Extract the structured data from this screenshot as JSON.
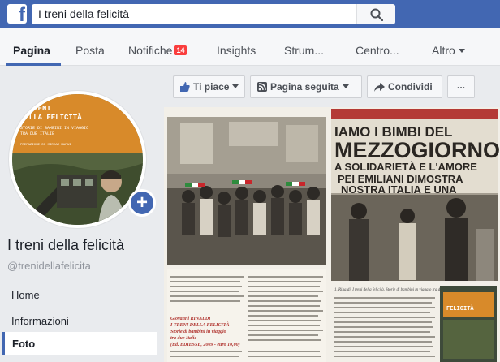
{
  "header": {
    "logo": "f",
    "search_value": "I treni della felicità",
    "search_icon": "search-icon"
  },
  "nav": {
    "tabs": [
      {
        "label": "Pagina"
      },
      {
        "label": "Posta"
      },
      {
        "label": "Notifiche",
        "badge": "14"
      },
      {
        "label": "Insights"
      },
      {
        "label": "Strum..."
      },
      {
        "label": "Centro..."
      },
      {
        "label": "Altro"
      }
    ],
    "active_tab": "Pagina"
  },
  "sidebar": {
    "profile_image_text": {
      "line1": "I TRENI",
      "line2": "DELLA FELICITÀ",
      "line3": "STORIE DI BAMBINI IN VIAGGIO",
      "line4": "TRA DUE ITALIE",
      "line5": "PREFAZIONE DI MIRIAM MAFAI"
    },
    "page_name": "I treni della felicità",
    "handle": "@trenidellafelicita",
    "items": [
      "Home",
      "Informazioni",
      "Foto"
    ],
    "selected_item": "Foto"
  },
  "actions": {
    "like": "Ti piace",
    "follow": "Pagina seguita",
    "share": "Condividi",
    "more": "..."
  },
  "photo": {
    "banner_left": "IAMO I BIMBI DEL",
    "banner_big": "MEZZOGIORNO",
    "banner_line3": "A SOLIDARIETÀ E L'AMORE",
    "banner_line4": "PEI EMILIANI DIMOSTRA",
    "banner_line5": "NOSTRA ITALIA E UNA",
    "article_title": "Giovanni RINALDI\nI TRENI DELLA FELICITÀ\nStorie di bambini in viaggio tra due Italie\n(Ed. EDIESSE, 2009 - euro 10,00)",
    "caption": "1. Rinaldi, I treni della felicità. Storie di bambini in viaggio tra due Italie",
    "right_caption": "FELICITÀ"
  },
  "colors": {
    "brand": "#4267b2",
    "badge": "#fa3e3e",
    "profile_orange": "#d88a2a"
  }
}
